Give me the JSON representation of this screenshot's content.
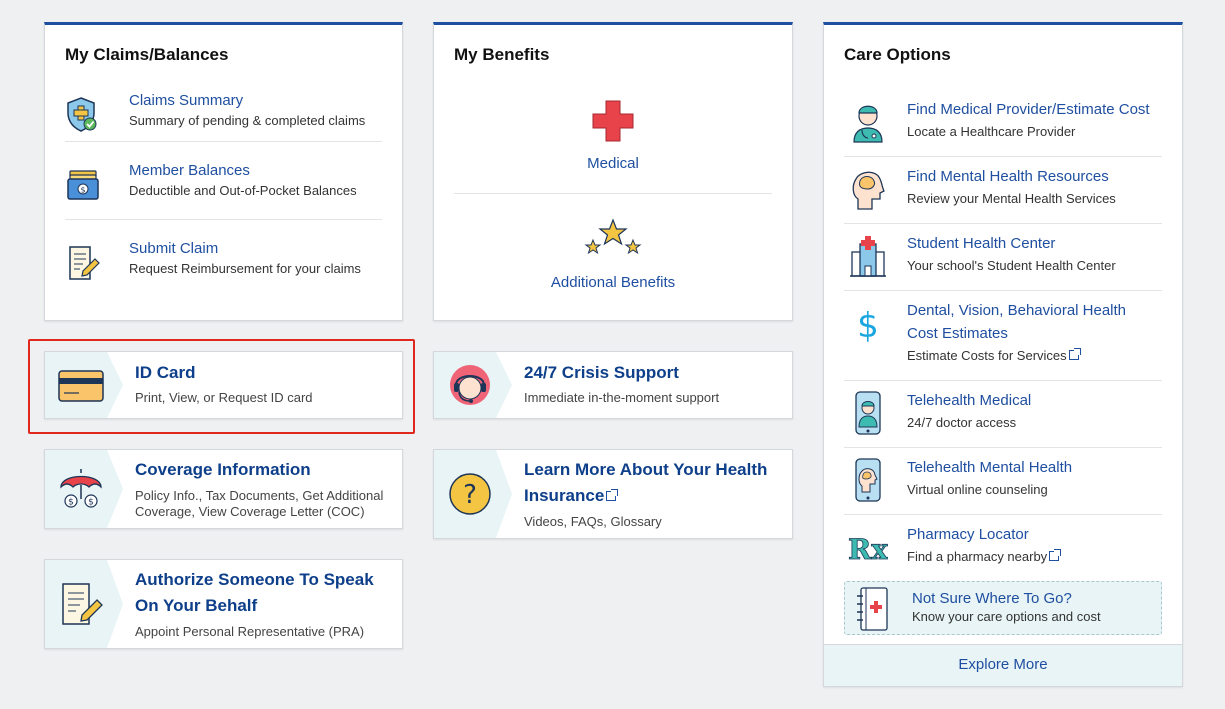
{
  "claims": {
    "title": "My Claims/Balances",
    "items": [
      {
        "title": "Claims Summary",
        "sub": "Summary of pending & completed claims",
        "icon": "shield-check-icon"
      },
      {
        "title": "Member Balances",
        "sub": "Deductible and Out-of-Pocket Balances",
        "icon": "wallet-icon"
      },
      {
        "title": "Submit Claim",
        "sub": "Request Reimbursement for your claims",
        "icon": "document-pen-icon"
      }
    ]
  },
  "benefits": {
    "title": "My Benefits",
    "items": [
      {
        "title": "Medical",
        "icon": "medical-cross-icon"
      },
      {
        "title": "Additional Benefits",
        "icon": "stars-icon"
      }
    ]
  },
  "tiles": {
    "id_card": {
      "title": "ID Card",
      "sub": "Print, View, or Request ID card",
      "icon": "id-card-icon"
    },
    "crisis": {
      "title": "24/7 Crisis Support",
      "sub": "Immediate in-the-moment support",
      "icon": "headset-person-icon"
    },
    "coverage": {
      "title": "Coverage Information",
      "sub1": "Policy Info., Tax Documents, Get Additional",
      "sub2": "Coverage, View Coverage Letter (COC)",
      "icon": "umbrella-icon"
    },
    "learn": {
      "title1": "Learn More About Your Health",
      "title2": "Insurance",
      "sub": "Videos, FAQs, Glossary",
      "icon": "question-icon"
    },
    "authorize": {
      "title1": "Authorize Someone To Speak",
      "title2": "On Your Behalf",
      "sub": "Appoint Personal Representative (PRA)",
      "icon": "document-pen-icon"
    }
  },
  "care": {
    "title": "Care Options",
    "items": [
      {
        "title": "Find Medical Provider/Estimate Cost",
        "sub": "Locate a Healthcare Provider",
        "icon": "doctor-icon"
      },
      {
        "title": "Find Mental Health Resources",
        "sub": "Review your Mental Health Services",
        "icon": "head-brain-icon"
      },
      {
        "title": "Student Health Center",
        "sub": "Your school's Student Health Center",
        "icon": "hospital-icon"
      },
      {
        "title1": "Dental, Vision, Behavioral Health",
        "title2": "Cost Estimates",
        "sub": "Estimate Costs for Services",
        "icon": "dollar-icon"
      },
      {
        "title": "Telehealth Medical",
        "sub": "24/7 doctor access",
        "icon": "phone-doctor-icon"
      },
      {
        "title": "Telehealth Mental Health",
        "sub": "Virtual online counseling",
        "icon": "phone-brain-icon"
      },
      {
        "title": "Pharmacy Locator",
        "sub": "Find a pharmacy nearby",
        "icon": "rx-icon"
      }
    ],
    "not_sure": {
      "title": "Not Sure Where To Go?",
      "sub": "Know your care options and cost",
      "icon": "notebook-medical-icon"
    },
    "explore": "Explore More"
  },
  "colors": {
    "accent": "#1f4fa0",
    "highlight": "#e0281f",
    "tile_side": "#e8f4f6"
  }
}
